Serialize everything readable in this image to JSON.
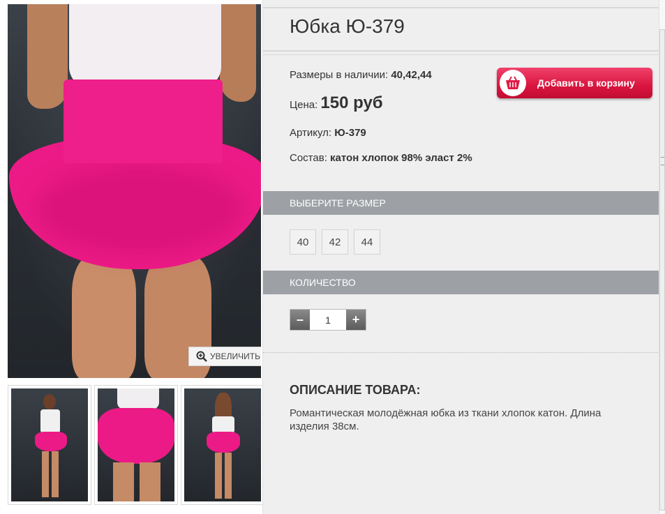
{
  "product": {
    "title": "Юбка Ю-379",
    "sizes_label": "Размеры в наличии:",
    "sizes_value": "40,42,44",
    "price_label": "Цена:",
    "price_value": "150 руб",
    "article_label": "Артикул:",
    "article_value": "Ю-379",
    "composition_label": "Состав:",
    "composition_value": "катон хлопок 98% эласт 2%"
  },
  "cart_button": {
    "label": "Добавить в корзину",
    "icon": "basket-icon",
    "color": "#e01a44"
  },
  "gallery": {
    "zoom_label": "УВЕЛИЧИТЬ",
    "zoom_icon": "magnifier-plus-icon",
    "accent_color": "#ec1a86",
    "thumbnails": [
      "full-length-front",
      "skirt-closeup",
      "full-length-back"
    ]
  },
  "size_section": {
    "header": "ВЫБЕРИТЕ РАЗМЕР",
    "options": [
      "40",
      "42",
      "44"
    ]
  },
  "quantity_section": {
    "header": "КОЛИЧЕСТВО",
    "value": "1",
    "minus": "–",
    "plus": "+"
  },
  "description": {
    "title": "ОПИСАНИЕ ТОВАРА:",
    "text": "Романтическая молодёжная юбка из ткани хлопок катон. Длина изделия 38см."
  }
}
